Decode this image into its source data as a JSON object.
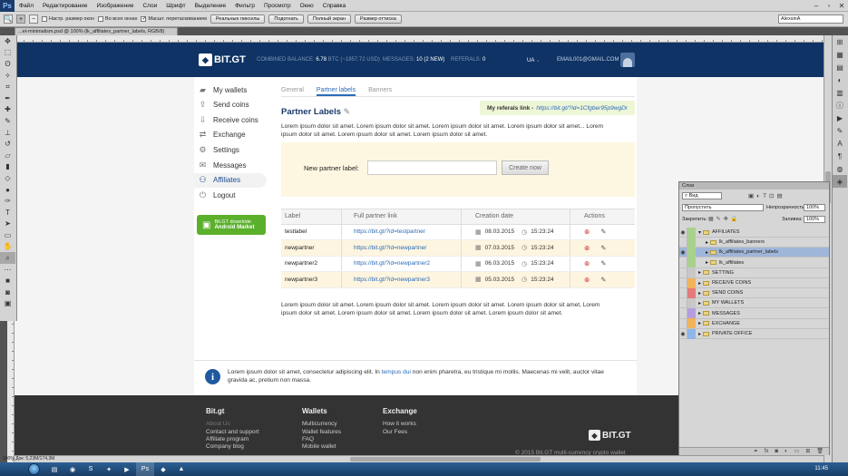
{
  "app": {
    "logo": "Ps",
    "menu": [
      "Файл",
      "Редактирование",
      "Изображение",
      "Слои",
      "Шрифт",
      "Выделение",
      "Фильтр",
      "Просмотр",
      "Окно",
      "Справка"
    ]
  },
  "options": {
    "check1": "Настр. размер окон",
    "check2": "Во всех окнах",
    "check3": "Масшт. перетаскиванием",
    "btn1": "Реальные пикселы",
    "btn2": "Подогнать",
    "btn3": "Полный экран",
    "btn4": "Размер оттиска",
    "workspace": "AlexsinA"
  },
  "document": {
    "tab": "...et-minimalism.psd @ 100% (lk_affiliates_partner_labels, RGB/8)",
    "status": "100%",
    "size": "Док: 5,23M/174,3M"
  },
  "site": {
    "logo": "BIT.GT",
    "balance_label": "COMBINED BALANCE:",
    "balance_value": "6.78",
    "balance_unit": "BTC (~1857.72 USD)",
    "messages_label": "MESSAGES:",
    "messages_value": "10",
    "messages_new": "(2 NEW)",
    "referals_label": "REFERALS:",
    "referals_value": "0",
    "lang": "UA",
    "email": "EMAIL001@GMAIL.COM",
    "sidebar": [
      {
        "label": "My wallets",
        "icon": "wallet-icon",
        "glyph": "▰"
      },
      {
        "label": "Send coins",
        "icon": "send-icon",
        "glyph": "⇪"
      },
      {
        "label": "Receive coins",
        "icon": "receive-icon",
        "glyph": "⇩"
      },
      {
        "label": "Exchange",
        "icon": "exchange-icon",
        "glyph": "⇄"
      },
      {
        "label": "Settings",
        "icon": "gear-icon",
        "glyph": "⚙"
      },
      {
        "label": "Messages",
        "icon": "mail-icon",
        "glyph": "✉"
      },
      {
        "label": "Affiliates",
        "icon": "affiliates-icon",
        "glyph": "⚇"
      },
      {
        "label": "Logout",
        "icon": "power-icon",
        "glyph": "⏻"
      }
    ],
    "android": {
      "line1": "Bit.GT downlode",
      "line2": "Android Market"
    },
    "tabs": [
      "General",
      "Partner labels",
      "Banners"
    ],
    "reflink_label": "My referals link -",
    "reflink_url": "https://bit.gt/?id=1Cfgber95p9wgDr",
    "page_title": "Partner Labels",
    "intro": "Lorem ipsum dolor sit amet. Lorem ipsum dolor sit amet. Lorem ipsum dolor sit amet. Lorem ipsum dolor sit amet... Lorem ipsum dolor sit amet. Lorem ipsum dolor sit amet. Lorem ipsum dolor sit amet.",
    "add_label": "New partner label:",
    "add_value": "",
    "create_btn": "Create now",
    "table": {
      "headers": [
        "Label",
        "Full partner link",
        "Creation date",
        "Actions"
      ],
      "rows": [
        {
          "label": "testlabel",
          "link": "https://bit.gt/?id=testpartner",
          "date": "08.03.2015",
          "time": "15:23:24"
        },
        {
          "label": "newpartner",
          "link": "https://bit.gt/?id=newpartner",
          "date": "07.03.2015",
          "time": "15:23:24"
        },
        {
          "label": "newpartner2",
          "link": "https://bit.gt/?id=newpartner2",
          "date": "06.03.2015",
          "time": "15:23:24"
        },
        {
          "label": "newpartner3",
          "link": "https://bit.gt/?id=newpartner3",
          "date": "05.03.2015",
          "time": "15:23:24"
        }
      ]
    },
    "outro": "Lorem ipsum dolor sit amet. Lorem ipsum dolor sit amet. Lorem ipsum dolor sit amet. Lorem ipsum dolor sit amet, Lorem ipsum dolor sit amet. Lorem ipsum dolor sit amet. Lorem ipsum dolor sit amet. Lorem ipsum dolor sit amet.",
    "info_pre": "Lorem ipsum dolor sit amet, consectetur adipiscing elit. In ",
    "info_link": "tempus dui",
    "info_post": " non enim pharetra, eu tristique mi mollis. Maecenas mi velit, auctor vitae gravida ac, pretium non massa.",
    "footer": {
      "col1": {
        "title": "Bit.gt",
        "items": [
          "About Us",
          "Contact and support",
          "Affiliate program",
          "Company blog"
        ]
      },
      "col2": {
        "title": "Wallets",
        "items": [
          "Multicurrency",
          "Wallet features",
          "FAQ",
          "Mobile wallet"
        ]
      },
      "col3": {
        "title": "Exchange",
        "items": [
          "How it works",
          "Our Fees"
        ]
      },
      "logo": "BIT.GT",
      "copy": "© 2015 Bit.GT multi-currency crypto wallet"
    }
  },
  "layers": {
    "title": "Слои",
    "kind": "Вид",
    "blend": "Пропустить",
    "opacity_label": "Непрозрачность:",
    "opacity": "100%",
    "lock_label": "Закрепить:",
    "fill_label": "Заливка:",
    "fill": "100%",
    "rows": [
      {
        "name": "AFFILIATES",
        "indent": 0,
        "open": true,
        "color": "#a9d18e",
        "eye": true,
        "sel": false
      },
      {
        "name": "lk_affiliates_banners",
        "indent": 1,
        "open": false,
        "color": "#a9d18e",
        "eye": false,
        "sel": false
      },
      {
        "name": "lk_affiliates_partner_labels",
        "indent": 1,
        "open": false,
        "color": "#a9d18e",
        "eye": true,
        "sel": true
      },
      {
        "name": "lk_affiliates",
        "indent": 1,
        "open": false,
        "color": "#a9d18e",
        "eye": false,
        "sel": false
      },
      {
        "name": "SETTING",
        "indent": 0,
        "open": false,
        "color": "#c8c8c8",
        "eye": false,
        "sel": false
      },
      {
        "name": "RECEIVE COINS",
        "indent": 0,
        "open": false,
        "color": "#f0b45a",
        "eye": false,
        "sel": false
      },
      {
        "name": "SEND COINS",
        "indent": 0,
        "open": false,
        "color": "#e57b7b",
        "eye": false,
        "sel": false
      },
      {
        "name": "MY WALLETS",
        "indent": 0,
        "open": false,
        "color": "#c8c8c8",
        "eye": false,
        "sel": false
      },
      {
        "name": "MESSAGES",
        "indent": 0,
        "open": false,
        "color": "#b59ee0",
        "eye": false,
        "sel": false
      },
      {
        "name": "EXCHANGE",
        "indent": 0,
        "open": false,
        "color": "#f0b45a",
        "eye": false,
        "sel": false
      },
      {
        "name": "PRIVATE OFFICE",
        "indent": 0,
        "open": false,
        "color": "#8fb6e8",
        "eye": true,
        "sel": false
      }
    ]
  },
  "taskbar": {
    "clock": "11:45"
  }
}
